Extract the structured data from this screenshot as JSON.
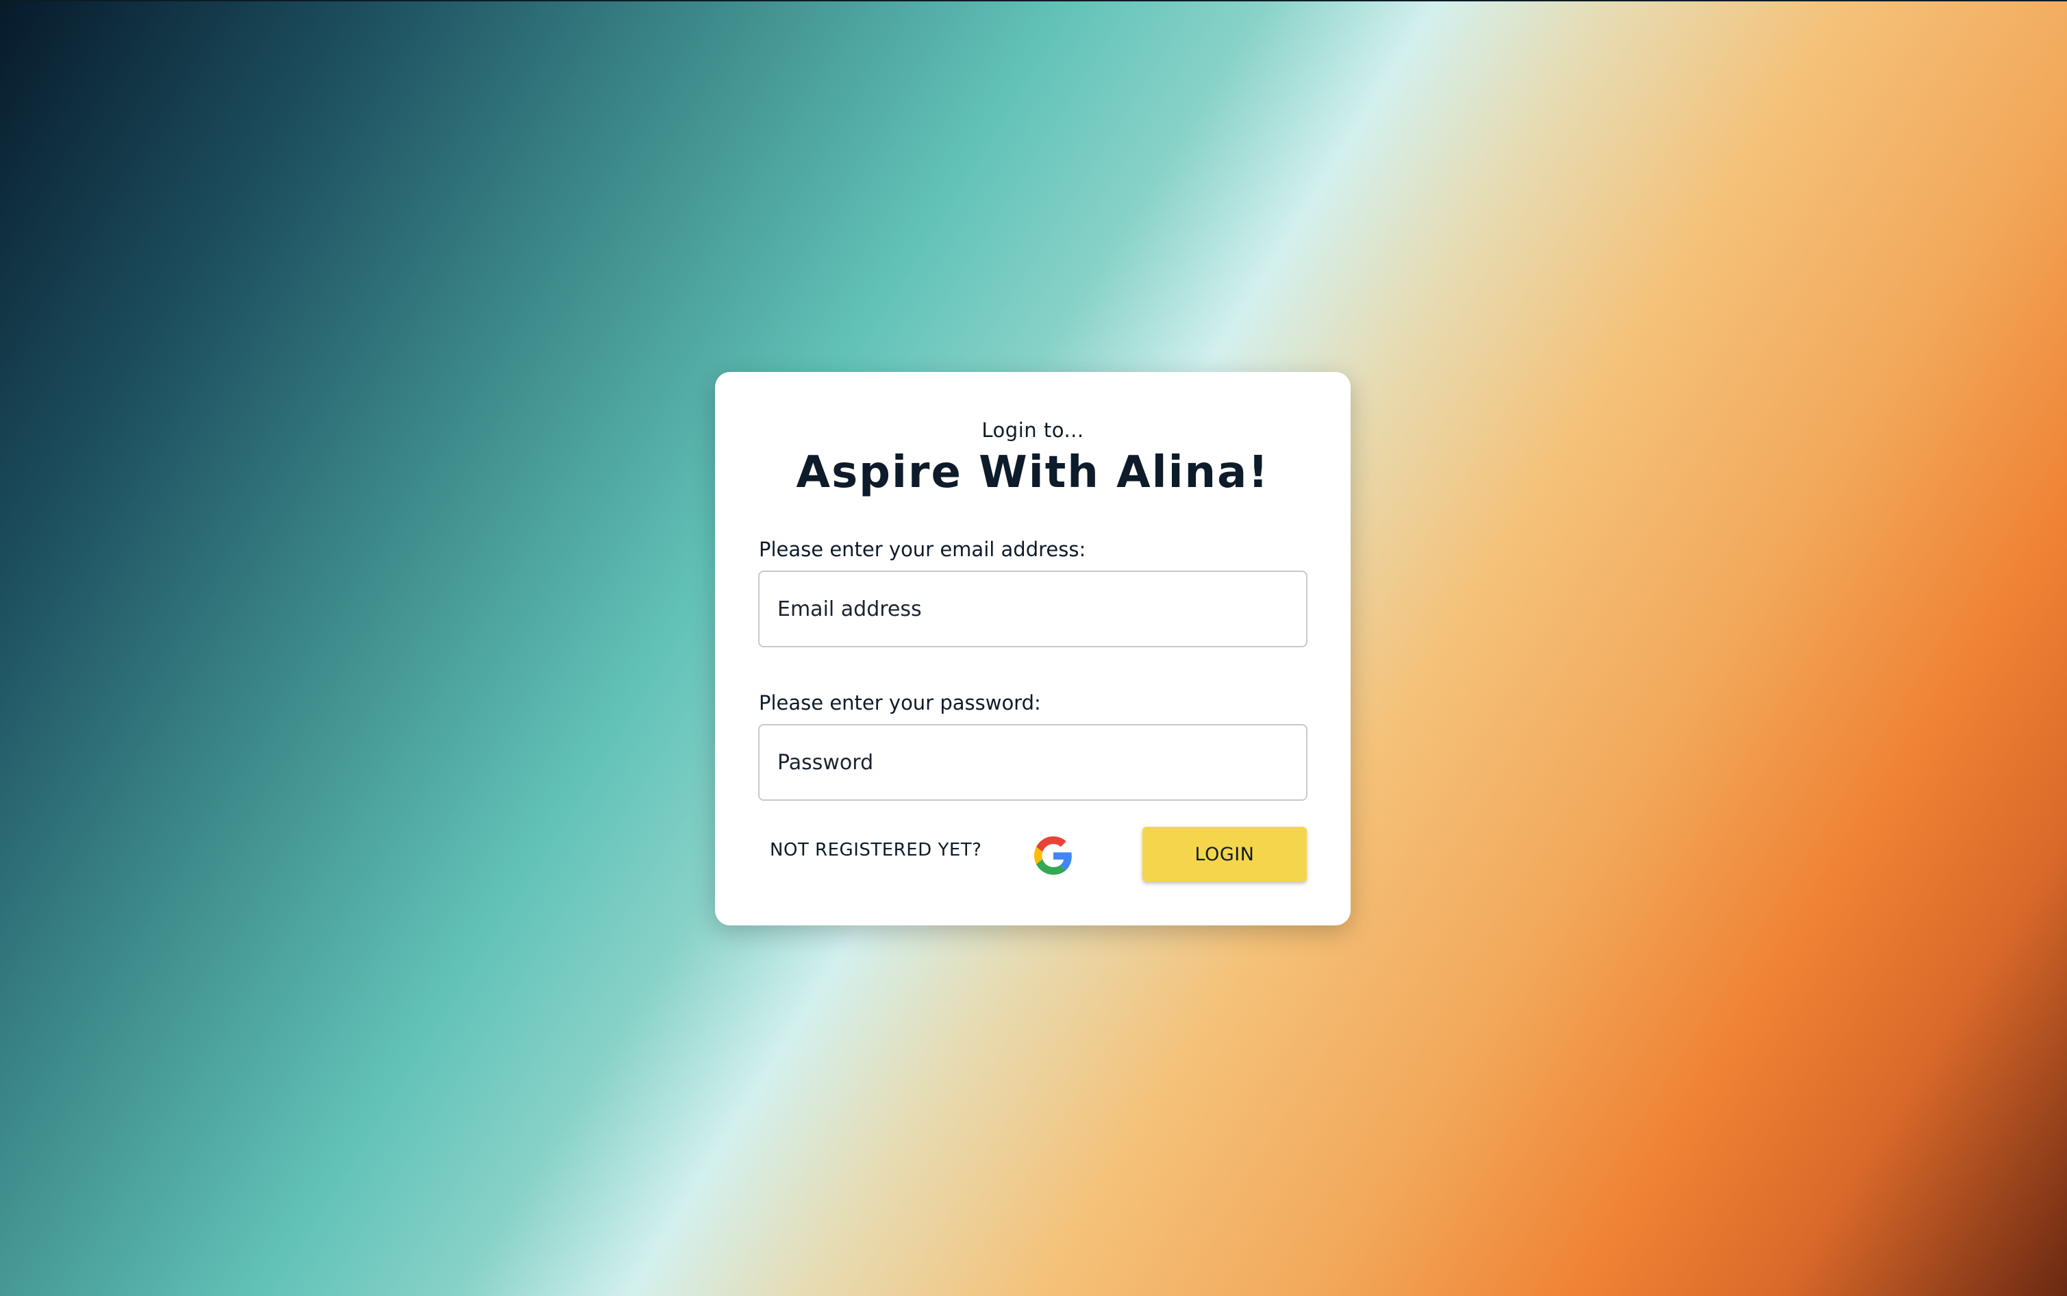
{
  "login_card": {
    "subtitle": "Login to...",
    "title": "Aspire With Alina!",
    "email": {
      "label": "Please enter your email address:",
      "placeholder": "Email address",
      "value": ""
    },
    "password": {
      "label": "Please enter your password:",
      "placeholder": "Password",
      "value": ""
    },
    "register_link": "NOT REGISTERED YET?",
    "google_icon": "google-g-logo",
    "login_button": "LOGIN"
  },
  "colors": {
    "accent_button": "#f5d54c",
    "text": "#0d1b2a",
    "card_background": "#ffffff"
  }
}
